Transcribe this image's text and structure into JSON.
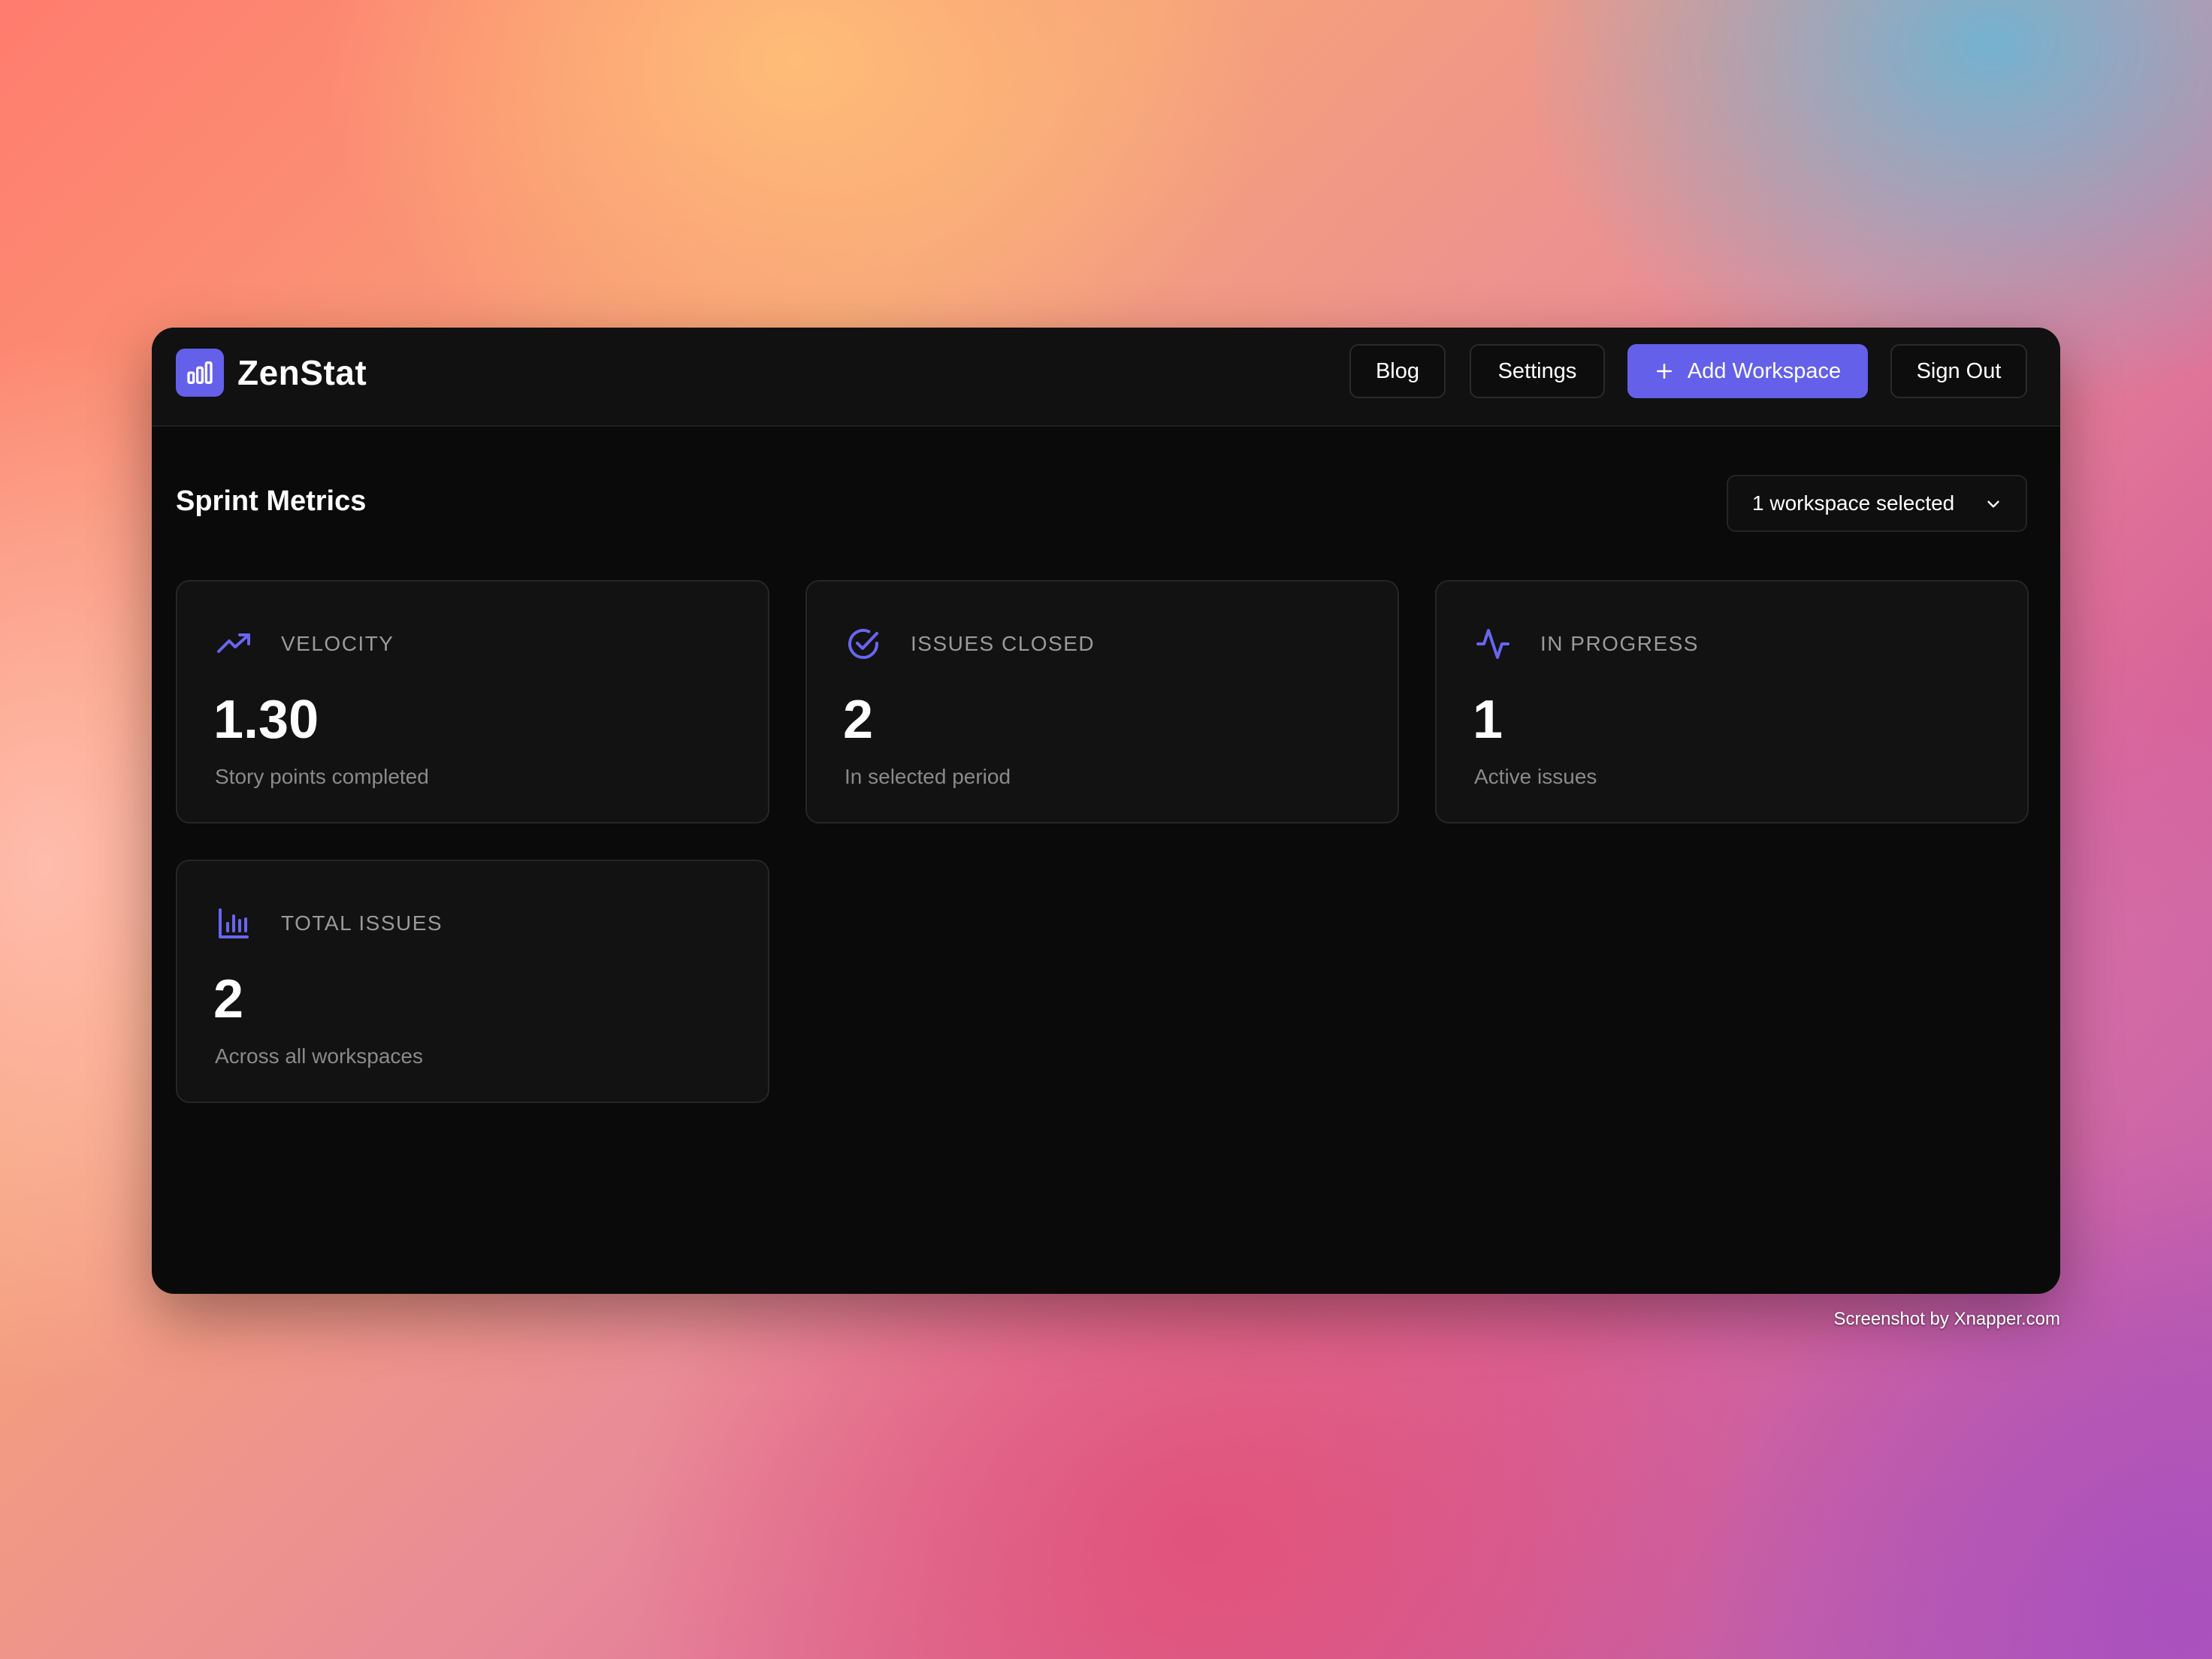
{
  "app": {
    "name": "ZenStat",
    "logo_icon": "bar-chart-icon",
    "accent_color": "#6460ea"
  },
  "header": {
    "nav": {
      "blog_label": "Blog",
      "settings_label": "Settings",
      "add_workspace_label": "Add Workspace",
      "sign_out_label": "Sign Out"
    }
  },
  "main": {
    "title": "Sprint Metrics",
    "workspace_selector": {
      "value": "1 workspace selected"
    },
    "cards": [
      {
        "label": "VELOCITY",
        "value": "1.30",
        "subtitle": "Story points completed",
        "icon": "trending-up-icon"
      },
      {
        "label": "ISSUES CLOSED",
        "value": "2",
        "subtitle": "In selected period",
        "icon": "check-circle-icon"
      },
      {
        "label": "IN PROGRESS",
        "value": "1",
        "subtitle": "Active issues",
        "icon": "activity-icon"
      },
      {
        "label": "TOTAL ISSUES",
        "value": "2",
        "subtitle": "Across all workspaces",
        "icon": "bar-chart-icon"
      }
    ]
  },
  "watermark": "Screenshot by Xnapper.com"
}
